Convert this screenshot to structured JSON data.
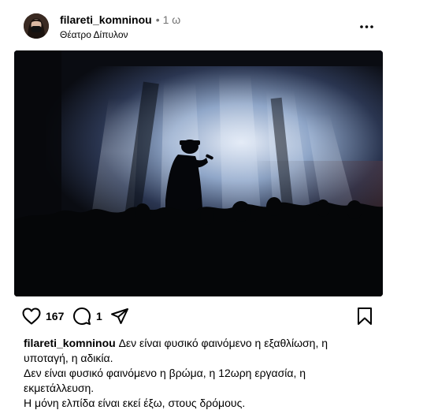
{
  "post": {
    "username": "filareti_komninou",
    "separator": "•",
    "time": "1 ω",
    "location": "Θέατρο Δίπυλον"
  },
  "actions": {
    "likes": "167",
    "comments": "1"
  },
  "caption": {
    "username": "filareti_komninou",
    "line1": "Δεν είναι φυσικό φαινόμενο η εξαθλίωση, η υποταγή, η αδικία.",
    "line2": "Δεν είναι φυσικό φαινόμενο η βρώμα, η 12ωρη εργασία, η εκμετάλλευση.",
    "line3": "Η μόνη ελπίδα είναι εκεί έξω, στους δρόμους."
  },
  "icons": {
    "like": "heart-icon",
    "comment": "comment-icon",
    "share": "send-icon",
    "save": "bookmark-icon",
    "more": "more-dots-icon"
  },
  "colors": {
    "text": "#000000",
    "muted": "#737373",
    "background": "#ffffff"
  }
}
